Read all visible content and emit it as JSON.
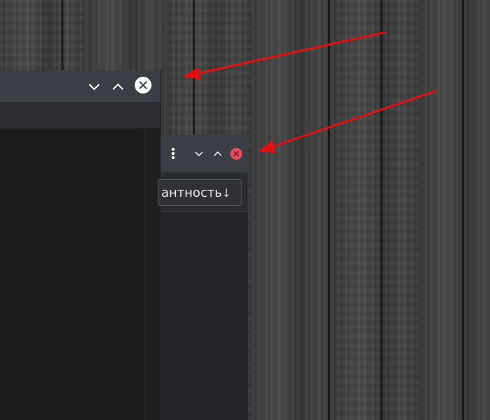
{
  "desktop": {
    "wallpaper": "dark-wood-planks"
  },
  "window_large": {
    "controls": {
      "minimize_icon": "chevron-down-icon",
      "maximize_icon": "chevron-up-icon",
      "close_icon": "close-icon"
    }
  },
  "window_small": {
    "controls": {
      "menu_icon": "vertical-dots-icon",
      "minimize_icon": "chevron-down-icon",
      "maximize_icon": "chevron-up-icon",
      "close_icon": "close-icon"
    },
    "sort_button": {
      "label": "антность",
      "arrow": "🡓"
    }
  },
  "colors": {
    "titlebar": "#3b3f45",
    "content_dark": "#1c1c1c",
    "close_white": "#ffffff",
    "close_red": "#e3505f",
    "annotation_arrow": "#e01010"
  }
}
